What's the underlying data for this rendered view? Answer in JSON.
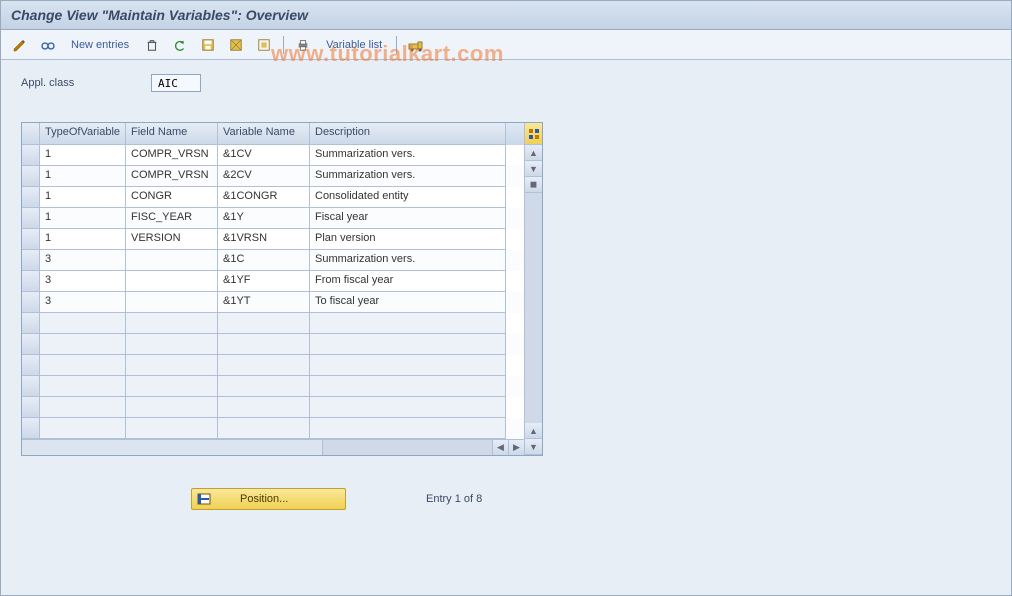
{
  "title": "Change View \"Maintain Variables\": Overview",
  "toolbar": {
    "new_entries": "New entries",
    "variable_list": "Variable list"
  },
  "appl_class": {
    "label": "Appl. class",
    "value": "AIC"
  },
  "columns": {
    "c1": "TypeOfVariable",
    "c2": "Field Name",
    "c3": "Variable Name",
    "c4": "Description"
  },
  "rows": [
    {
      "type": "1",
      "field": "COMPR_VRSN",
      "var": "&1CV",
      "desc": "Summarization vers."
    },
    {
      "type": "1",
      "field": "COMPR_VRSN",
      "var": "&2CV",
      "desc": "Summarization vers."
    },
    {
      "type": "1",
      "field": "CONGR",
      "var": "&1CONGR",
      "desc": "Consolidated entity"
    },
    {
      "type": "1",
      "field": "FISC_YEAR",
      "var": "&1Y",
      "desc": "Fiscal year"
    },
    {
      "type": "1",
      "field": "VERSION",
      "var": "&1VRSN",
      "desc": "Plan version"
    },
    {
      "type": "3",
      "field": "",
      "var": "&1C",
      "desc": "Summarization vers."
    },
    {
      "type": "3",
      "field": "",
      "var": "&1YF",
      "desc": "From fiscal year"
    },
    {
      "type": "3",
      "field": "",
      "var": "&1YT",
      "desc": "To fiscal year"
    }
  ],
  "empty_rows": 6,
  "footer": {
    "position": "Position...",
    "entry_text": "Entry 1 of 8"
  },
  "watermark": "www.tutorialkart.com"
}
